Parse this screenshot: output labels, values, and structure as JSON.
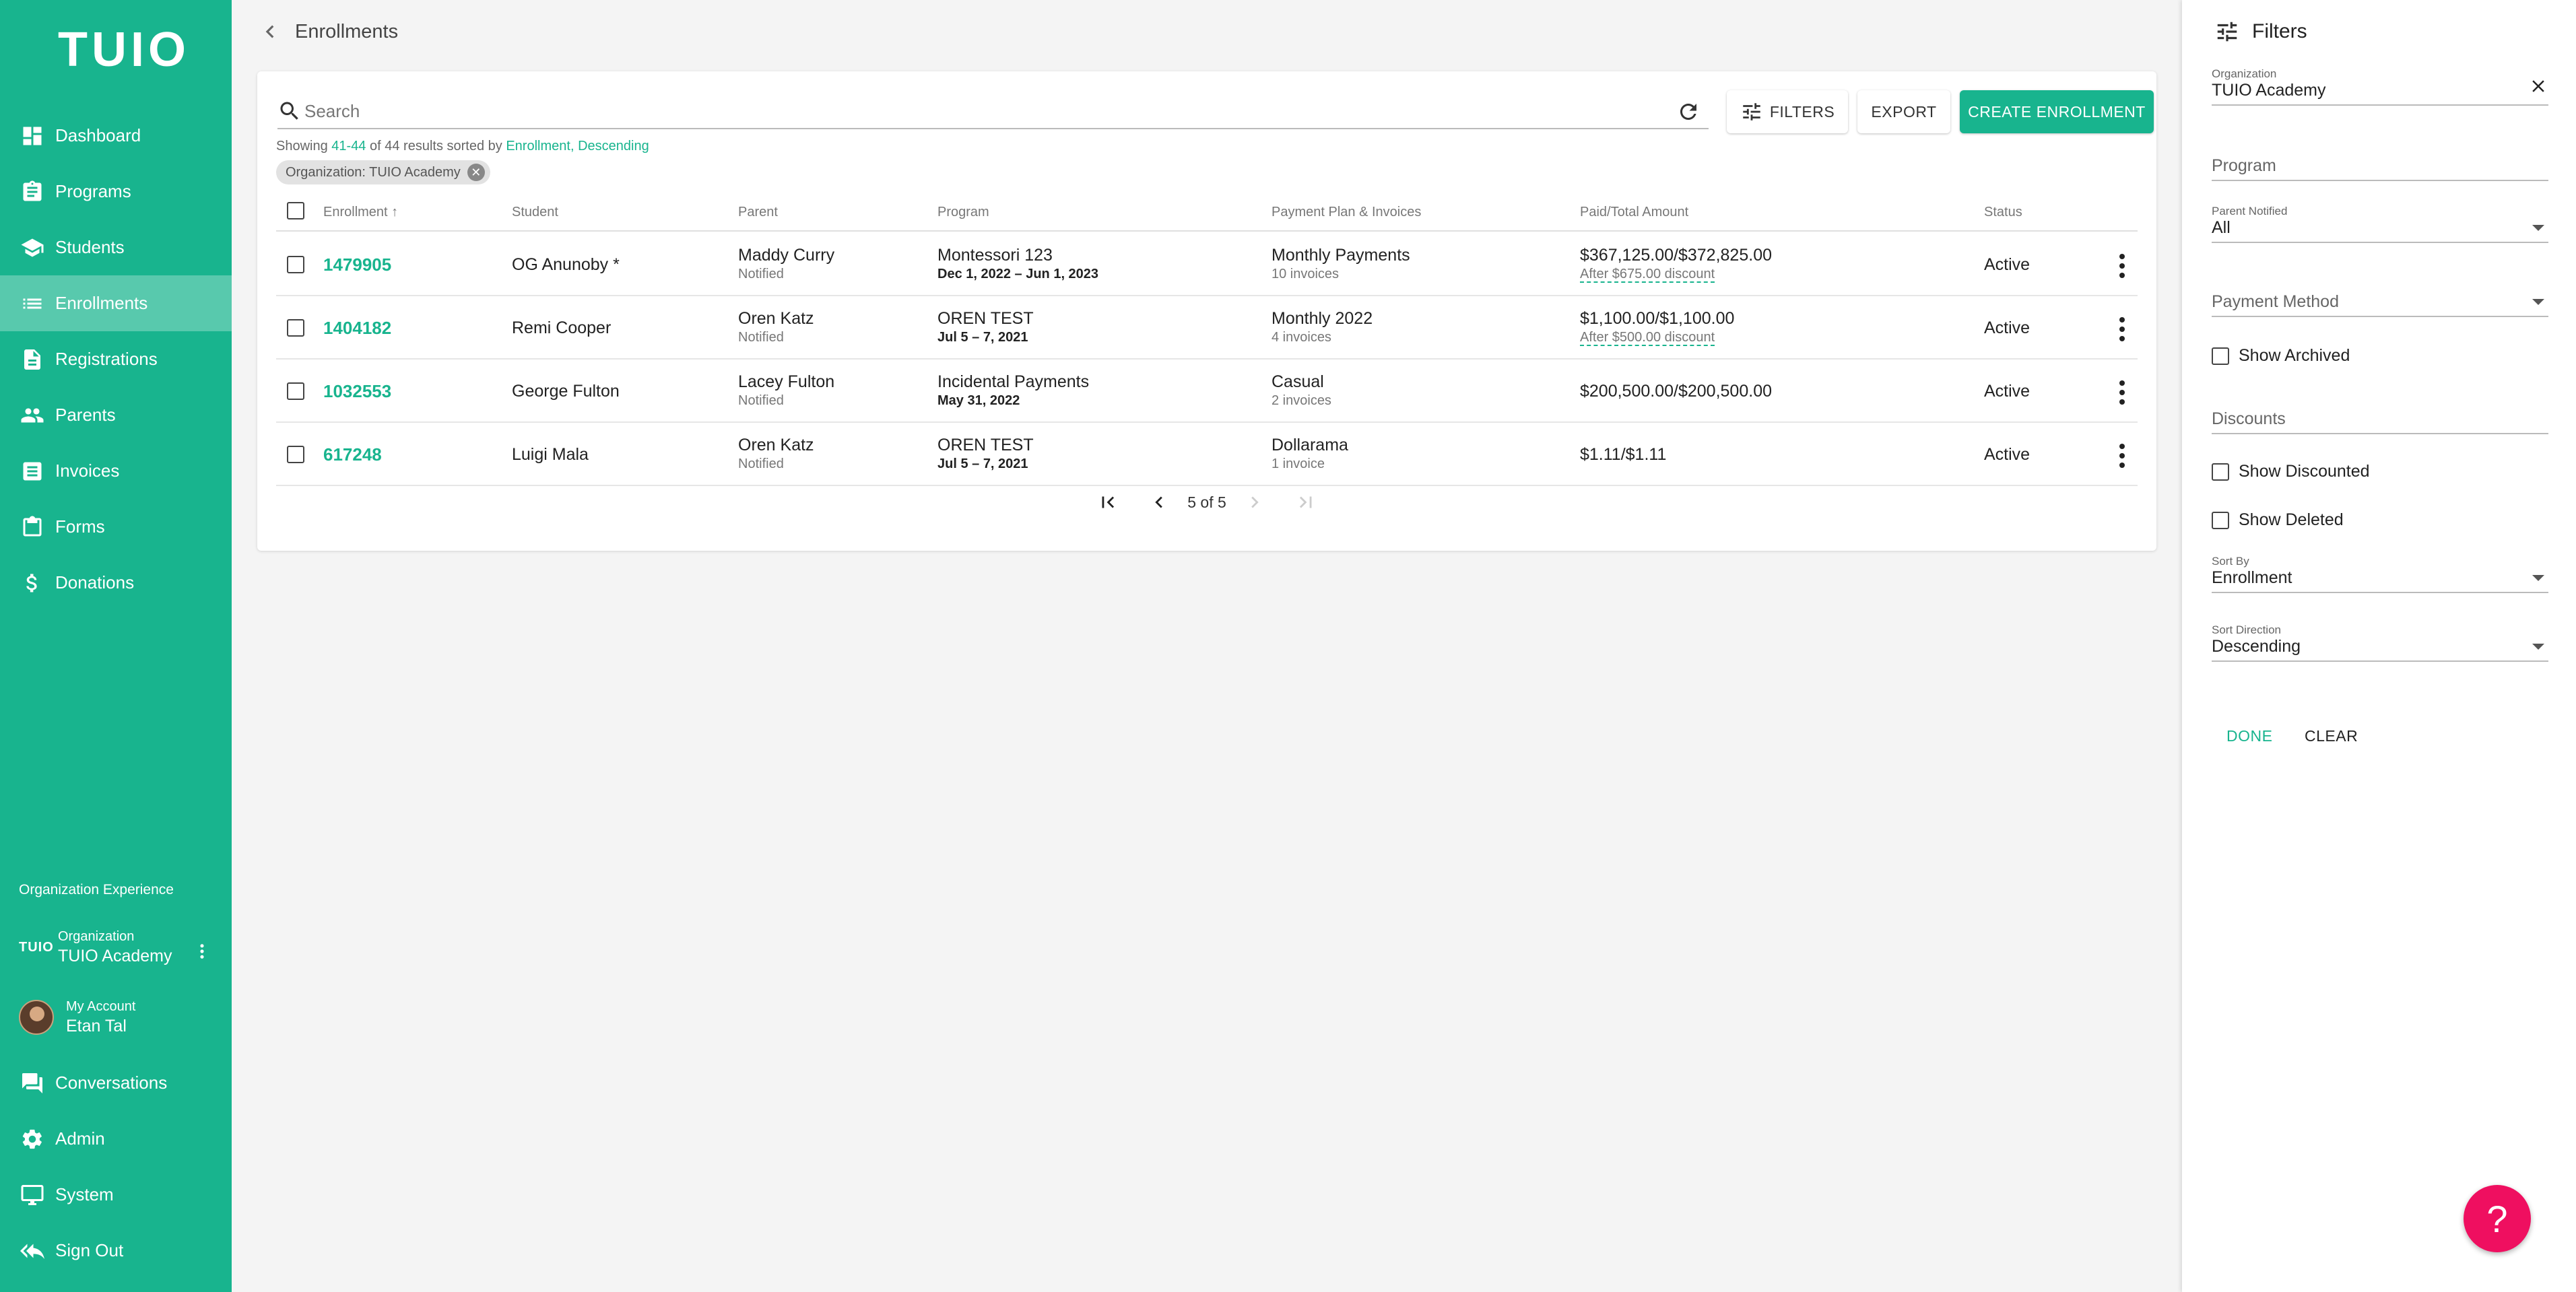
{
  "brand": {
    "logo_text": "TUIO",
    "accent": "#18b48e",
    "help_color": "#ef0f60"
  },
  "sidebar": {
    "items": [
      {
        "label": "Dashboard",
        "icon": "dashboard-icon"
      },
      {
        "label": "Programs",
        "icon": "clipboard-icon"
      },
      {
        "label": "Students",
        "icon": "graduation-cap-icon"
      },
      {
        "label": "Enrollments",
        "icon": "list-icon",
        "active": true
      },
      {
        "label": "Registrations",
        "icon": "document-icon"
      },
      {
        "label": "Parents",
        "icon": "people-icon"
      },
      {
        "label": "Invoices",
        "icon": "receipt-icon"
      },
      {
        "label": "Forms",
        "icon": "clipboard-icon"
      },
      {
        "label": "Donations",
        "icon": "dollar-icon"
      }
    ],
    "org_experience": "Organization Experience",
    "organization": {
      "badge": "TUIO",
      "label": "Organization",
      "name": "TUIO Academy"
    },
    "account": {
      "label": "My Account",
      "name": "Etan Tal"
    },
    "bottom_items": [
      {
        "label": "Conversations",
        "icon": "chat-icon"
      },
      {
        "label": "Admin",
        "icon": "gear-icon"
      },
      {
        "label": "System",
        "icon": "monitor-icon"
      },
      {
        "label": "Sign Out",
        "icon": "reply-all-icon"
      }
    ]
  },
  "page": {
    "title": "Enrollments"
  },
  "toolbar": {
    "search_placeholder": "Search",
    "filters_label": "FILTERS",
    "export_label": "EXPORT",
    "create_label": "CREATE ENROLLMENT"
  },
  "results": {
    "prefix": "Showing",
    "range": "41-44",
    "middle": "of 44 results sorted by",
    "sort_field": "Enrollment",
    "sep": ",",
    "sort_dir": "Descending",
    "chip": "Organization: TUIO Academy"
  },
  "table": {
    "columns": [
      "Enrollment",
      "Student",
      "Parent",
      "Program",
      "Payment Plan & Invoices",
      "Paid/Total Amount",
      "Status"
    ],
    "rows": [
      {
        "enrollment": "1479905",
        "student": "OG Anunoby *",
        "parent": "Maddy Curry",
        "parent_status": "Notified",
        "program": "Montessori 123",
        "dates": "Dec 1, 2022 – Jun 1, 2023",
        "plan": "Monthly Payments",
        "invoices": "10 invoices",
        "amount": "$367,125.00/$372,825.00",
        "discount": "After $675.00 discount",
        "status": "Active"
      },
      {
        "enrollment": "1404182",
        "student": "Remi Cooper",
        "parent": "Oren Katz",
        "parent_status": "Notified",
        "program": "OREN TEST",
        "dates": "Jul 5 – 7, 2021",
        "plan": "Monthly 2022",
        "invoices": "4 invoices",
        "amount": "$1,100.00/$1,100.00",
        "discount": "After $500.00 discount",
        "status": "Active"
      },
      {
        "enrollment": "1032553",
        "student": "George Fulton",
        "parent": "Lacey Fulton",
        "parent_status": "Notified",
        "program": "Incidental Payments",
        "dates": "May 31, 2022",
        "plan": "Casual",
        "invoices": "2 invoices",
        "amount": "$200,500.00/$200,500.00",
        "discount": "",
        "status": "Active"
      },
      {
        "enrollment": "617248",
        "student": "Luigi Mala",
        "parent": "Oren Katz",
        "parent_status": "Notified",
        "program": "OREN TEST",
        "dates": "Jul 5 – 7, 2021",
        "plan": "Dollarama",
        "invoices": "1 invoice",
        "amount": "$1.11/$1.11",
        "discount": "",
        "status": "Active"
      }
    ]
  },
  "pagination": {
    "text": "5 of 5"
  },
  "filters": {
    "title": "Filters",
    "organization_label": "Organization",
    "organization_value": "TUIO Academy",
    "program_placeholder": "Program",
    "parent_notified_label": "Parent Notified",
    "parent_notified_value": "All",
    "payment_method_placeholder": "Payment Method",
    "show_archived": "Show Archived",
    "discounts_placeholder": "Discounts",
    "show_discounted": "Show Discounted",
    "show_deleted": "Show Deleted",
    "sort_by_label": "Sort By",
    "sort_by_value": "Enrollment",
    "sort_direction_label": "Sort Direction",
    "sort_direction_value": "Descending",
    "done_label": "DONE",
    "clear_label": "CLEAR"
  },
  "help": {
    "symbol": "?"
  }
}
